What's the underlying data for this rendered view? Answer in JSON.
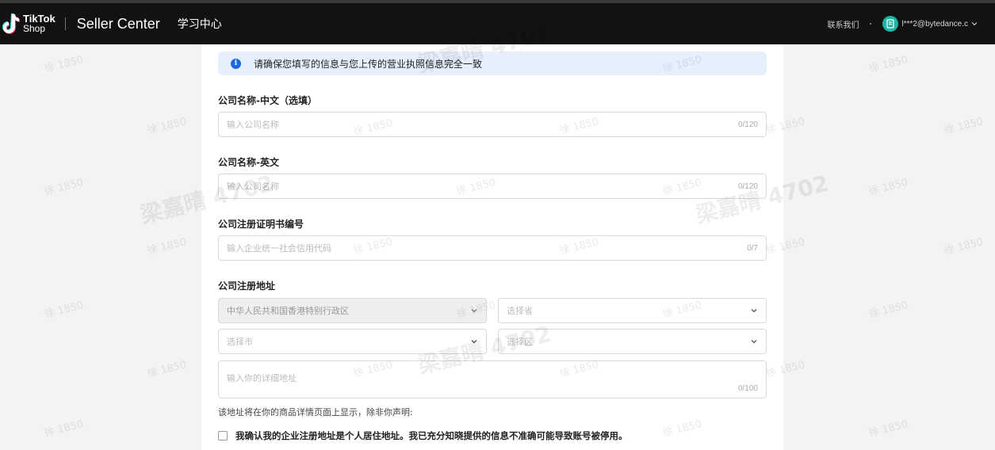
{
  "header": {
    "logo_line1": "TikTok",
    "logo_line2": "Shop",
    "title": "Seller Center",
    "learning_center": "学习中心",
    "contact_us": "联系我们",
    "account": "l***2@bytedance.c"
  },
  "form": {
    "info_banner": "请确保您填写的信息与您上传的营业执照信息完全一致",
    "company_name_cn": {
      "label": "公司名称-中文（选填）",
      "placeholder": "输入公司名称",
      "counter": "0/120"
    },
    "company_name_en": {
      "label": "公司名称-英文",
      "placeholder": "输入公司名称",
      "counter": "0/120"
    },
    "registration_no": {
      "label": "公司注册证明书编号",
      "placeholder": "输入企业统一社会信用代码",
      "counter": "0/7"
    },
    "address": {
      "label": "公司注册地址",
      "region": "中华人民共和国香港特别行政区",
      "province_placeholder": "选择省",
      "city_placeholder": "选择市",
      "district_placeholder": "选择区",
      "detail_placeholder": "输入你的详细地址",
      "detail_counter": "0/100"
    },
    "address_note": "该地址将在你的商品详情页面上显示，除非你声明:",
    "confirm_text": "我确认我的企业注册地址是个人居住地址。我已充分知晓提供的信息不准确可能导致账号被停用。"
  },
  "watermark": {
    "small": "徐 1850",
    "big": "梁嘉晴 4702"
  },
  "colors": {
    "topbar": "#121212",
    "info_bg": "#e6f0fd",
    "info_icon": "#1c66e8",
    "avatar": "#1eb3a3"
  }
}
